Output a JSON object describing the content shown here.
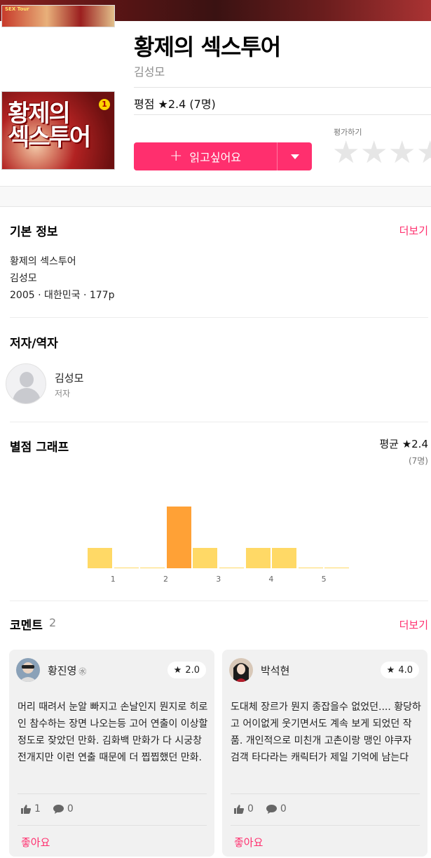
{
  "book": {
    "cover_text_small": "SEX Tour",
    "cover_title": "황제의 섹스투어",
    "cover_volume": "1",
    "title": "황제의 섹스투어",
    "author": "김성모",
    "rating_label": "평점 ★2.4 (7명)"
  },
  "actions": {
    "wish_label": "읽고싶어요",
    "rate_label": "평가하기"
  },
  "basic_info": {
    "title": "기본 정보",
    "more": "더보기",
    "lines": [
      "황제의 섹스투어",
      "김성모",
      "2005 · 대한민국 · 177p"
    ]
  },
  "people": {
    "title": "저자/역자",
    "items": [
      {
        "name": "김성모",
        "role": "저자"
      }
    ]
  },
  "graph": {
    "title": "별점 그래프",
    "average_label": "평균 ★2.4",
    "count_label": "(7명)"
  },
  "chart_data": {
    "type": "bar",
    "categories": [
      "0.5",
      "1",
      "1.5",
      "2",
      "2.5",
      "3",
      "3.5",
      "4",
      "4.5",
      "5"
    ],
    "values": [
      1,
      0,
      0,
      3,
      1,
      0,
      1,
      1,
      0,
      0
    ],
    "tick_labels": [
      "1",
      "2",
      "3",
      "4",
      "5"
    ],
    "highlight_index": 3,
    "colors": {
      "normal": "#ffd966",
      "highlight": "#ffa136"
    }
  },
  "comments": {
    "title": "코멘트",
    "count": "2",
    "more": "더보기",
    "items": [
      {
        "user": "황진영",
        "badge": "㊌",
        "score": "2.0",
        "text": "머리 때려서 눈알 빠지고 손날인지 뭔지로 히로인 참수하는 장면 나오는등 고어 연출이 이상할 정도로 잦았던 만화. 김화백 만화가 다 시궁창 전개지만 이런 연출 때문에 더 찝찝했던 만화.",
        "likes": "1",
        "replies": "0",
        "like_label": "좋아요"
      },
      {
        "user": "박석현",
        "badge": "",
        "score": "4.0",
        "text": "도대체 장르가 뭔지 종잡을수 없었던.... 황당하고 어이없게 웃기면서도 계속 보게 되었던 작품. 개인적으로 미친개 고촌이랑 맹인 야쿠자 검객 타다라는 캐릭터가 제일 기억에 남는다",
        "likes": "0",
        "replies": "0",
        "like_label": "좋아요"
      }
    ]
  }
}
